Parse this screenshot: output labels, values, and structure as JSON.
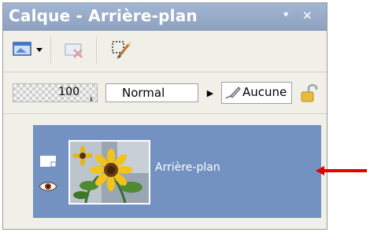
{
  "panel": {
    "title": "Calque - Arrière-plan",
    "pin_glyph": "⌖",
    "close_glyph": "✕"
  },
  "toolbar": {
    "icons": [
      "new-layer-icon",
      "dropdown-icon",
      "delete-layer-icon",
      "selection-brush-icon"
    ]
  },
  "properties": {
    "opacity": "100",
    "blend_mode": "Normal",
    "link": "Aucune"
  },
  "layers": [
    {
      "name": "Arrière-plan",
      "visible": true,
      "selected": true
    }
  ],
  "colors": {
    "title_bar": "#8ea2c0",
    "selected_row": "#7392c1",
    "arrow": "#e10000"
  }
}
